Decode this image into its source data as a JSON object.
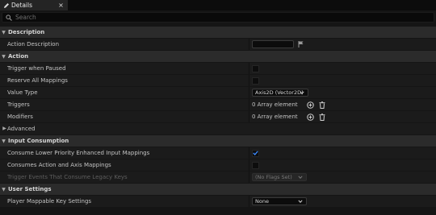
{
  "tab": {
    "title": "Details",
    "icon": "pencil-icon",
    "close": "×"
  },
  "search": {
    "placeholder": "Search"
  },
  "sections": {
    "description": {
      "title": "Description",
      "action_description": "Action Description"
    },
    "action": {
      "title": "Action",
      "trigger_when_paused": "Trigger when Paused",
      "reserve_all_mappings": "Reserve All Mappings",
      "value_type": "Value Type",
      "value_type_value": "Axis2D (Vector2D)",
      "triggers": "Triggers",
      "triggers_value": "0 Array element",
      "modifiers": "Modifiers",
      "modifiers_value": "0 Array element",
      "advanced": "Advanced"
    },
    "input_consumption": {
      "title": "Input Consumption",
      "consume_lower_priority": "Consume Lower Priority Enhanced Input Mappings",
      "consume_lower_priority_checked": true,
      "consumes_action_and_axis": "Consumes Action and Axis Mappings",
      "consumes_action_and_axis_checked": false,
      "trigger_events_legacy": "Trigger Events That Consume Legacy Keys",
      "trigger_events_legacy_value": "(No Flags Set)"
    },
    "user_settings": {
      "title": "User Settings",
      "player_mappable": "Player Mappable Key Settings",
      "player_mappable_value": "None"
    }
  },
  "colors": {
    "checkmark": "#3d8bff",
    "background": "#151515",
    "category": "#2b2b2b",
    "row": "#1b1b1b"
  }
}
